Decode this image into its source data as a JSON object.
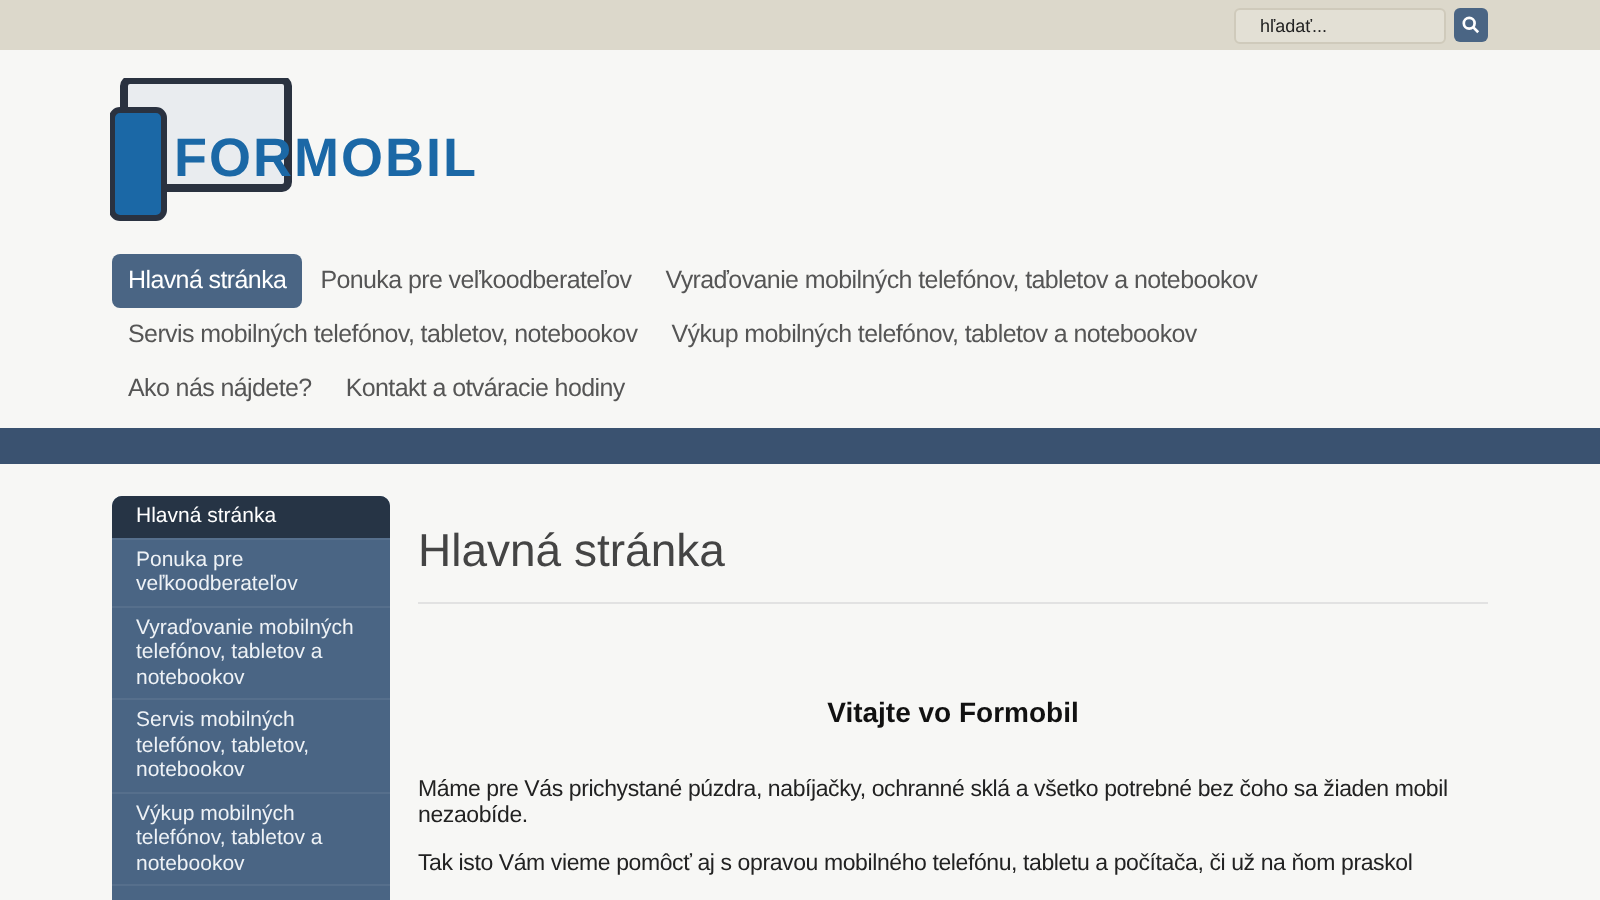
{
  "search": {
    "placeholder": "hľadať..."
  },
  "logo": {
    "text": "FORMOBIL"
  },
  "nav": [
    {
      "label": "Hlavná stránka",
      "selected": true
    },
    {
      "label": "Ponuka pre veľkoodberateľov",
      "selected": false
    },
    {
      "label": "Vyraďovanie mobilných telefónov, tabletov a notebookov",
      "selected": false
    },
    {
      "label": "Servis mobilných telefónov, tabletov, notebookov",
      "selected": false
    },
    {
      "label": "Výkup mobilných telefónov, tabletov a notebookov",
      "selected": false
    },
    {
      "label": "Ako nás nájdete?",
      "selected": false
    },
    {
      "label": "Kontakt a otváracie hodiny",
      "selected": false
    }
  ],
  "sidebar": [
    {
      "label": "Hlavná stránka",
      "selected": true
    },
    {
      "label": "Ponuka pre veľkoodberateľov",
      "selected": false
    },
    {
      "label": "Vyraďovanie mobilných telefónov, tabletov a notebookov",
      "selected": false
    },
    {
      "label": "Servis mobilných telefónov, tabletov, notebookov",
      "selected": false
    },
    {
      "label": "Výkup mobilných telefónov, tabletov a notebookov",
      "selected": false
    }
  ],
  "content": {
    "title": "Hlavná stránka",
    "heading": "Vitajte vo Formobil",
    "paragraphs": [
      "Máme pre Vás prichystané púzdra, nabíjačky, ochranné sklá a všetko potrebné bez čoho sa žiaden mobil nezaobíde.",
      "Tak isto Vám vieme pomôcť aj s opravou mobilného telefónu, tabletu a počítača, či už na ňom praskol"
    ]
  }
}
